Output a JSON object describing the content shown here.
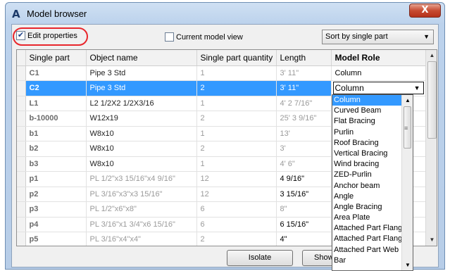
{
  "window": {
    "title": "Model browser",
    "app_icon_glyph": "A",
    "close_glyph": "X"
  },
  "toolbar": {
    "edit_properties": {
      "label": "Edit properties",
      "checked": true
    },
    "current_model_view": {
      "label": "Current model view",
      "checked": false
    },
    "sort": {
      "selected": "Sort by single part"
    }
  },
  "grid": {
    "columns": [
      "Single part",
      "Object name",
      "Single part quantity",
      "Length",
      "Model Role"
    ],
    "rows": [
      {
        "part": "C1",
        "name": "Pipe 3 Std",
        "qty": "1",
        "length": "3' 11\"",
        "role": "Column"
      },
      {
        "part": "C2",
        "name": "Pipe 3 Std",
        "qty": "2",
        "length": "3' 11\"",
        "role": "Column"
      },
      {
        "part": "L1",
        "name": "L2 1/2X2 1/2X3/16",
        "qty": "1",
        "length": "4' 2 7/16\"",
        "role": ""
      },
      {
        "part": "b-10000",
        "name": "W12x19",
        "qty": "2",
        "length": "25' 3 9/16\"",
        "role": ""
      },
      {
        "part": "b1",
        "name": "W8x10",
        "qty": "1",
        "length": "13'",
        "role": ""
      },
      {
        "part": "b2",
        "name": "W8x10",
        "qty": "2",
        "length": "3'",
        "role": ""
      },
      {
        "part": "b3",
        "name": "W8x10",
        "qty": "1",
        "length": "4' 6\"",
        "role": ""
      },
      {
        "part": "p1",
        "name": "PL 1/2\"x3 15/16\"x4 9/16\"",
        "qty": "12",
        "length": "4 9/16\"",
        "role": ""
      },
      {
        "part": "p2",
        "name": "PL 3/16\"x3\"x3 15/16\"",
        "qty": "12",
        "length": "3 15/16\"",
        "role": ""
      },
      {
        "part": "p3",
        "name": "PL 1/2\"x6\"x8\"",
        "qty": "6",
        "length": "8\"",
        "role": ""
      },
      {
        "part": "p4",
        "name": "PL 3/16\"x1 3/4\"x6 15/16\"",
        "qty": "6",
        "length": "6 15/16\"",
        "role": ""
      },
      {
        "part": "p5",
        "name": "PL 3/16\"x4\"x4\"",
        "qty": "2",
        "length": "4\"",
        "role": ""
      }
    ],
    "selected_row_index": 1
  },
  "role_dropdown": {
    "current": "Column",
    "options": [
      "Column",
      "Curved Beam",
      "Flat Bracing",
      "Purlin",
      "Roof Bracing",
      "Vertical Bracing",
      "Wind bracing",
      "ZED-Purlin",
      "Anchor beam",
      "Angle",
      "Angle Bracing",
      "Area Plate",
      "Attached Part Flange l",
      "Attached Part Flange",
      "Attached Part Web",
      "Bar"
    ]
  },
  "buttons": {
    "isolate": "Isolate",
    "show": "Show"
  },
  "colors": {
    "selection": "#3399ff",
    "highlight_ring": "#e8262c",
    "close_button": "#c74b32"
  }
}
